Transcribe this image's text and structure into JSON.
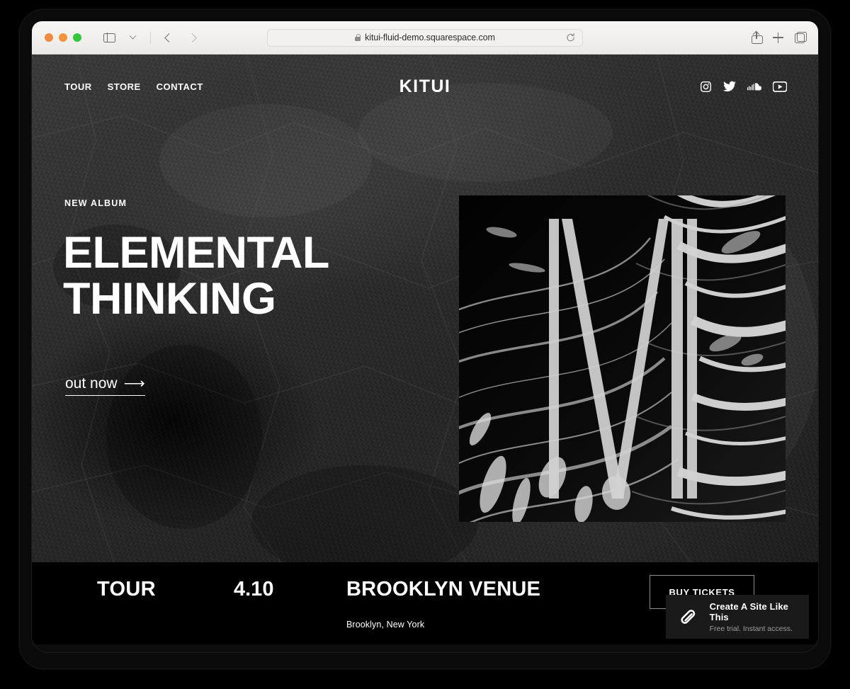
{
  "browser": {
    "url": "kitui-fluid-demo.squarespace.com",
    "lock_icon": "lock-icon",
    "reload_icon": "reload-icon",
    "sidebar_icon": "sidebar-icon",
    "chevron_icon": "chevron-down-icon",
    "back_icon": "back-arrow-icon",
    "forward_icon": "forward-arrow-icon",
    "share_icon": "share-icon",
    "new_tab_icon": "plus-icon",
    "tabs_icon": "tabs-overview-icon",
    "traffic_lights": [
      "close-button",
      "minimize-button",
      "zoom-button"
    ]
  },
  "site": {
    "brand": "KITUI",
    "nav": [
      {
        "label": "TOUR"
      },
      {
        "label": "STORE"
      },
      {
        "label": "CONTACT"
      }
    ],
    "socials": [
      {
        "name": "instagram-icon"
      },
      {
        "name": "twitter-icon"
      },
      {
        "name": "soundcloud-icon"
      },
      {
        "name": "youtube-icon"
      }
    ],
    "hero": {
      "eyebrow": "NEW ALBUM",
      "title_line1": "ELEMENTAL",
      "title_line2": "THINKING",
      "cta_label": "out now",
      "cta_arrow": "⟶",
      "album_art_alt": "fluid-marbled-album-cover"
    },
    "tour": {
      "label": "TOUR",
      "date": "4.10",
      "venue": "BROOKLYN VENUE",
      "city": "Brooklyn, New York",
      "tickets_label": "BUY TICKETS"
    }
  },
  "badge": {
    "logo": "squarespace-logo-icon",
    "title": "Create A Site Like This",
    "subtitle": "Free trial. Instant access."
  },
  "colors": {
    "page_bg": "#000000",
    "toolbar_bg": "#f1f0ee",
    "accent_text": "#ffffff",
    "badge_bg": "#1a1a1a",
    "muted_text": "#9d9d9d"
  }
}
